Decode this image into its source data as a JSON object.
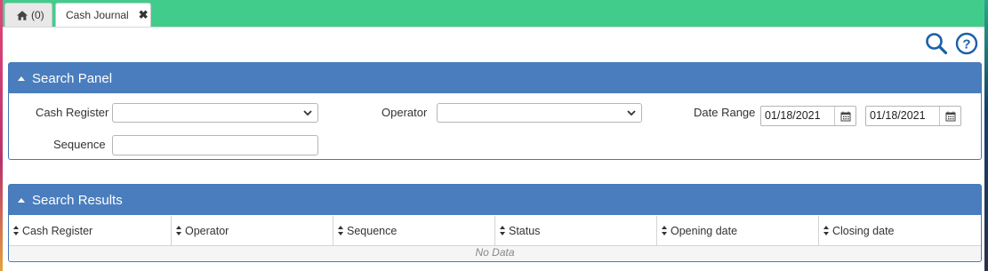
{
  "tabs": [
    {
      "label": "(0)",
      "icon": "home-icon"
    },
    {
      "label": "Cash Journal",
      "close_icon": "close-icon"
    }
  ],
  "toolbar": {
    "search_icon": "search-icon",
    "help_icon": "help-icon",
    "accent": "#1a5fa8"
  },
  "search_panel": {
    "title": "Search Panel",
    "cash_register_label": "Cash Register",
    "cash_register_value": "",
    "operator_label": "Operator",
    "operator_value": "",
    "date_range_label": "Date Range",
    "date_from": "01/18/2021",
    "date_to": "01/18/2021",
    "sequence_label": "Sequence",
    "sequence_value": ""
  },
  "search_results": {
    "title": "Search Results",
    "columns": [
      "Cash Register",
      "Operator",
      "Sequence",
      "Status",
      "Opening date",
      "Closing date"
    ],
    "empty_text": "No Data"
  },
  "colors": {
    "tab_bar": "#42cc8c",
    "panel_header": "#4a7dbd",
    "panel_border": "#4378b8"
  }
}
